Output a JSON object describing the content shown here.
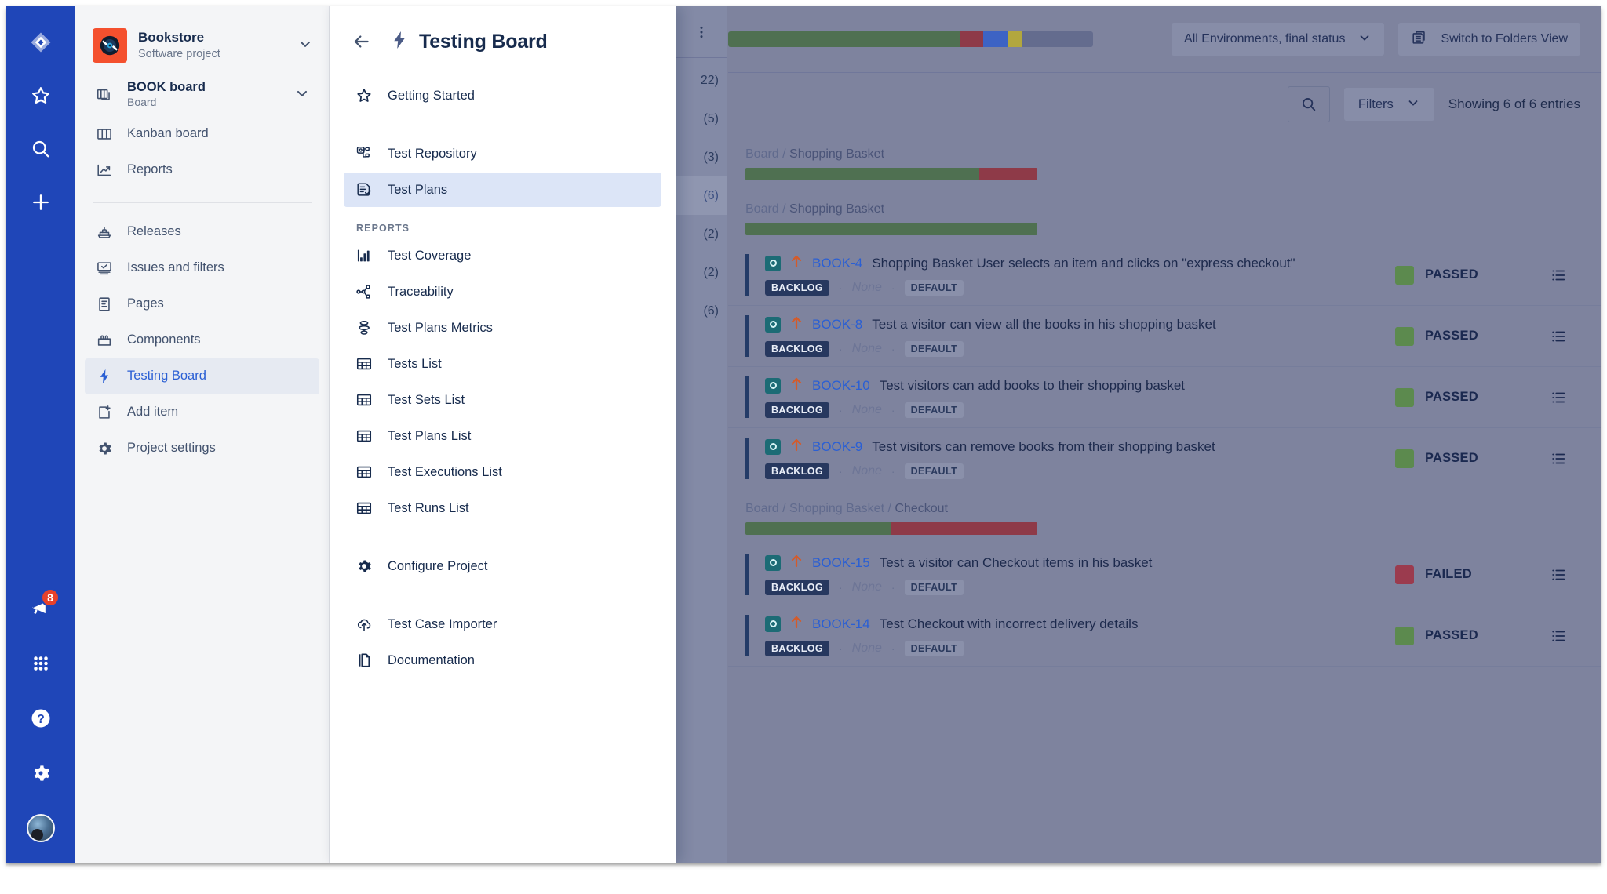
{
  "nav_rail": {
    "top_items": [
      {
        "name": "jira-logo-icon",
        "label": "Jira"
      },
      {
        "name": "starred-icon",
        "label": "Starred"
      },
      {
        "name": "search-icon",
        "label": "Search"
      },
      {
        "name": "create-icon",
        "label": "Create"
      }
    ],
    "bottom_items": [
      {
        "name": "announcements-icon",
        "label": "Announcements",
        "badge": "8"
      },
      {
        "name": "apps-grid-icon",
        "label": "Apps"
      },
      {
        "name": "help-icon",
        "label": "Help"
      },
      {
        "name": "settings-gear-icon",
        "label": "Settings"
      },
      {
        "name": "avatar",
        "label": "Your profile"
      }
    ]
  },
  "sidebar": {
    "project": {
      "name": "Bookstore",
      "type": "Software project",
      "logo_color": "#f4502e"
    },
    "board": {
      "name": "BOOK board",
      "type": "Board"
    },
    "board_items": [
      {
        "label": "Kanban board",
        "icon": "board-columns-icon"
      },
      {
        "label": "Reports",
        "icon": "reports-chart-icon"
      }
    ],
    "items": [
      {
        "label": "Releases",
        "icon": "releases-ship-icon",
        "selected": false
      },
      {
        "label": "Issues and filters",
        "icon": "issues-filters-icon",
        "selected": false
      },
      {
        "label": "Pages",
        "icon": "pages-document-icon",
        "selected": false
      },
      {
        "label": "Components",
        "icon": "components-icon",
        "selected": false
      },
      {
        "label": "Testing Board",
        "icon": "testing-board-bolt-icon",
        "selected": true
      },
      {
        "label": "Add item",
        "icon": "add-item-icon",
        "selected": false
      },
      {
        "label": "Project settings",
        "icon": "settings-gear-icon",
        "selected": false
      }
    ]
  },
  "panel": {
    "title": "Testing Board",
    "title_icon": "xray-bolt-icon",
    "back_icon": "arrow-left-icon",
    "top_items": [
      {
        "label": "Getting Started",
        "icon": "star-outline-icon",
        "selected": false
      }
    ],
    "main_items": [
      {
        "label": "Test Repository",
        "icon": "test-repository-icon",
        "selected": false
      },
      {
        "label": "Test Plans",
        "icon": "test-plans-icon",
        "selected": true
      }
    ],
    "reports_heading": "REPORTS",
    "reports_items": [
      {
        "label": "Test Coverage",
        "icon": "bar-chart-icon"
      },
      {
        "label": "Traceability",
        "icon": "traceability-icon"
      },
      {
        "label": "Test Plans Metrics",
        "icon": "metrics-icon"
      },
      {
        "label": "Tests List",
        "icon": "table-grid-icon"
      },
      {
        "label": "Test Sets List",
        "icon": "table-grid-icon"
      },
      {
        "label": "Test Plans List",
        "icon": "table-grid-icon"
      },
      {
        "label": "Test Executions List",
        "icon": "table-grid-icon"
      },
      {
        "label": "Test Runs List",
        "icon": "table-grid-icon"
      }
    ],
    "config_items": [
      {
        "label": "Configure Project",
        "icon": "settings-gear-icon"
      }
    ],
    "footer_items": [
      {
        "label": "Test Case Importer",
        "icon": "cloud-upload-icon"
      },
      {
        "label": "Documentation",
        "icon": "documents-icon"
      }
    ]
  },
  "tree_sliver": {
    "kebab_icon": "more-vertical-icon",
    "counts": [
      {
        "value": "22)",
        "highlighted": false
      },
      {
        "value": "(5)",
        "highlighted": false
      },
      {
        "value": "(3)",
        "highlighted": false
      },
      {
        "value": "(6)",
        "highlighted": true
      },
      {
        "value": "(2)",
        "highlighted": false
      },
      {
        "value": "(2)",
        "highlighted": false
      },
      {
        "value": "(6)",
        "highlighted": false
      }
    ]
  },
  "toolbar": {
    "overall_bar": [
      {
        "status": "passed",
        "color": "#4f7051",
        "percent": 63.5
      },
      {
        "status": "failed",
        "color": "#8e3a48",
        "percent": 6.5
      },
      {
        "status": "executing",
        "color": "#3d63c4",
        "percent": 6.5
      },
      {
        "status": "aborted",
        "color": "#b2a73e",
        "percent": 4.0
      },
      {
        "status": "todo",
        "color": "#646c8e",
        "percent": 19.5
      }
    ],
    "environment_select": {
      "label": "All Environments, final status",
      "chevron_icon": "chevron-down-icon"
    },
    "switch_view_button": {
      "label": "Switch to Folders View",
      "icon": "folders-view-icon"
    }
  },
  "filterbar": {
    "search_icon": "search-icon",
    "filters_label": "Filters",
    "filters_chevron": "chevron-down-icon",
    "showing_text": "Showing 6 of 6 entries"
  },
  "colors": {
    "passed": "#5c8a4e",
    "failed": "#9b3b4e",
    "accent_blue": "#2a5fd4",
    "backdrop": "#7e839e"
  },
  "groups": [
    {
      "breadcrumb_parts": [
        "Board",
        "Shopping Basket"
      ],
      "bar": [
        {
          "status": "passed",
          "color": "#4f7051",
          "percent": 80
        },
        {
          "status": "failed",
          "color": "#8e3a48",
          "percent": 20
        }
      ],
      "rows": []
    },
    {
      "breadcrumb_parts": [
        "Board",
        "Shopping Basket"
      ],
      "bar": [
        {
          "status": "passed",
          "color": "#4f7051",
          "percent": 100
        }
      ],
      "rows": [
        {
          "type_icon": "test-issue-icon",
          "priority_icon": "priority-high-icon",
          "key": "BOOK-4",
          "summary": "Shopping Basket User selects an item and clicks on \"express checkout\"",
          "status_tag": "BACKLOG",
          "assignee": "None",
          "env_tag": "DEFAULT",
          "result": "PASSED",
          "result_color": "#5c8a4e",
          "action_icon": "test-runs-list-icon"
        },
        {
          "type_icon": "test-issue-icon",
          "priority_icon": "priority-high-icon",
          "key": "BOOK-8",
          "summary": "Test a visitor can view all the books in his shopping basket",
          "status_tag": "BACKLOG",
          "assignee": "None",
          "env_tag": "DEFAULT",
          "result": "PASSED",
          "result_color": "#5c8a4e",
          "action_icon": "test-runs-list-icon"
        },
        {
          "type_icon": "test-issue-icon",
          "priority_icon": "priority-high-icon",
          "key": "BOOK-10",
          "summary": "Test visitors can add books to their shopping basket",
          "status_tag": "BACKLOG",
          "assignee": "None",
          "env_tag": "DEFAULT",
          "result": "PASSED",
          "result_color": "#5c8a4e",
          "action_icon": "test-runs-list-icon"
        },
        {
          "type_icon": "test-issue-icon",
          "priority_icon": "priority-high-icon",
          "key": "BOOK-9",
          "summary": "Test visitors can remove books from their shopping basket",
          "status_tag": "BACKLOG",
          "assignee": "None",
          "env_tag": "DEFAULT",
          "result": "PASSED",
          "result_color": "#5c8a4e",
          "action_icon": "test-runs-list-icon"
        }
      ]
    },
    {
      "breadcrumb_parts": [
        "Board",
        "Shopping Basket",
        "Checkout"
      ],
      "bar": [
        {
          "status": "passed",
          "color": "#4f7051",
          "percent": 50
        },
        {
          "status": "failed",
          "color": "#8e3a48",
          "percent": 50
        }
      ],
      "rows": [
        {
          "type_icon": "test-issue-icon",
          "priority_icon": "priority-high-icon",
          "key": "BOOK-15",
          "summary": "Test a visitor can Checkout items in his basket",
          "status_tag": "BACKLOG",
          "assignee": "None",
          "env_tag": "DEFAULT",
          "result": "FAILED",
          "result_color": "#9b3b4e",
          "action_icon": "test-runs-list-icon"
        },
        {
          "type_icon": "test-issue-icon",
          "priority_icon": "priority-high-icon",
          "key": "BOOK-14",
          "summary": "Test Checkout with incorrect delivery details",
          "status_tag": "BACKLOG",
          "assignee": "None",
          "env_tag": "DEFAULT",
          "result": "PASSED",
          "result_color": "#5c8a4e",
          "action_icon": "test-runs-list-icon"
        }
      ]
    }
  ]
}
